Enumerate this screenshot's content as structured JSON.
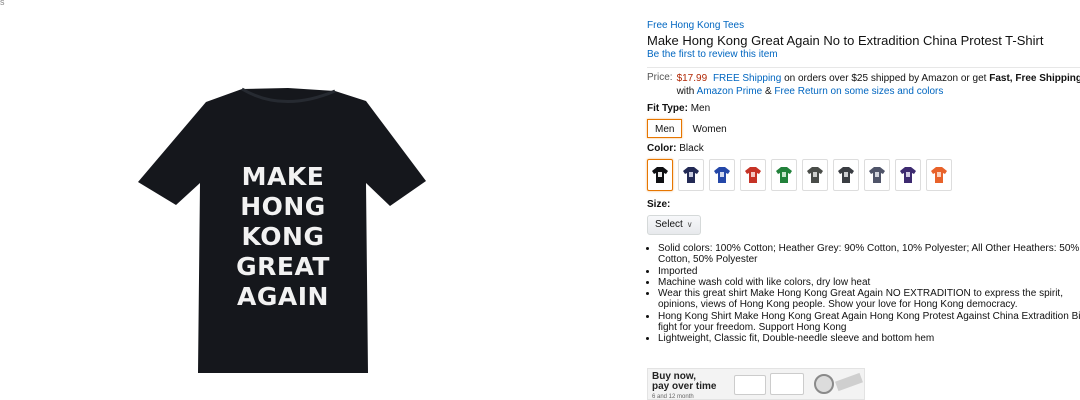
{
  "page": {
    "corner_mark": "s"
  },
  "product": {
    "brand": "Free Hong Kong Tees",
    "title": "Make Hong Kong Great Again No to Extradition China Protest T-Shirt",
    "review_link": "Be the first to review this item",
    "image_text": [
      "MAKE",
      "HONG",
      "KONG",
      "GREAT",
      "AGAIN"
    ],
    "shirt_color": "#15171c",
    "image_text_color": "#f2f2f2"
  },
  "price": {
    "label": "Price:",
    "value": "$17.99",
    "free_shipping": "FREE Shipping",
    "shipping_text": "on orders over $25 shipped by Amazon or get",
    "fast_shipping": "Fast, Free Shipping",
    "with_text": "with",
    "prime_link": "Amazon Prime",
    "amp": "&",
    "return_link": "Free Return on some sizes and colors",
    "price_color": "#b12704"
  },
  "fit_type": {
    "label": "Fit Type:",
    "selected": "Men",
    "options": [
      "Men",
      "Women"
    ]
  },
  "color": {
    "label": "Color:",
    "selected": "Black",
    "swatches": [
      {
        "color": "#0e0f12",
        "accent": "#e6e6e6"
      },
      {
        "color": "#232a55",
        "accent": "#c9cce0"
      },
      {
        "color": "#2447a8",
        "accent": "#d0d8f0"
      },
      {
        "color": "#c63326",
        "accent": "#f3c8c2"
      },
      {
        "color": "#22813b",
        "accent": "#c7e4cd"
      },
      {
        "color": "#4a4d49",
        "accent": "#cfd0ce"
      },
      {
        "color": "#3a3d42",
        "accent": "#cdced0"
      },
      {
        "color": "#4f5469",
        "accent": "#d2d4dc"
      },
      {
        "color": "#3d2a70",
        "accent": "#d2cbe4"
      },
      {
        "color": "#e8622a",
        "accent": "#fbd2bf"
      }
    ]
  },
  "size": {
    "label": "Size:",
    "select_value": "Select"
  },
  "bullets": [
    "Solid colors: 100% Cotton; Heather Grey: 90% Cotton, 10% Polyester; All Other Heathers: 50% Cotton, 50% Polyester",
    "Imported",
    "Machine wash cold with like colors, dry low heat",
    "Wear this great shirt Make Hong Kong Great Again NO EXTRADITION to express the spirit, opinions, views of Hong Kong people. Show your love for Hong Kong democracy.",
    "Hong Kong Shirt Make Hong Kong Great Again Hong Kong Protest Against China Extradition Bill fight for your freedom. Support Hong Kong",
    "Lightweight, Classic fit, Double-needle sleeve and bottom hem"
  ],
  "ad": {
    "line1": "Buy now,",
    "line2": "pay over time",
    "line3": "6 and 12 month"
  }
}
